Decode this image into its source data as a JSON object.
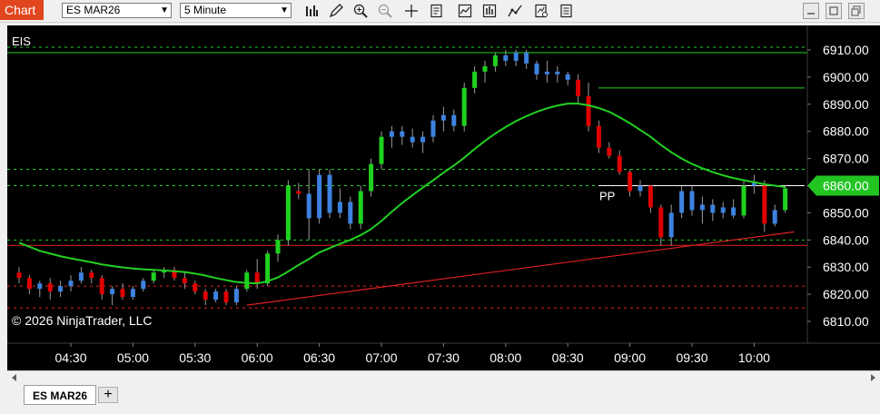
{
  "toolbar": {
    "chart_tab": "Chart",
    "instrument": "ES MAR26",
    "interval": "5 Minute",
    "tools": [
      "bars-icon",
      "pencil-icon",
      "zoom-in-icon",
      "zoom-out-icon",
      "crosshair-icon",
      "data-box-icon",
      "indicators-icon",
      "strategies-icon",
      "drawing-tools-icon",
      "properties-icon",
      "templates-icon"
    ]
  },
  "chart": {
    "instrument_label": "EIS",
    "copyright": "© 2026 NinjaTrader, LLC",
    "pp_label": "PP",
    "price_label": "6860.00",
    "colors": {
      "up": "#1ed21e",
      "down": "#e00000",
      "neutral": "#3d82e0",
      "wick": "#9a9a9a",
      "ma": "#22d022",
      "trend": "#e02020"
    },
    "price_axis": [
      "6910.00",
      "6900.00",
      "6890.00",
      "6880.00",
      "6870.00",
      "6860.00",
      "6850.00",
      "6840.00",
      "6830.00",
      "6820.00",
      "6810.00"
    ],
    "time_axis": [
      "04:30",
      "05:00",
      "05:30",
      "06:00",
      "06:30",
      "07:00",
      "07:30",
      "08:00",
      "08:30",
      "09:00",
      "09:30",
      "10:00"
    ]
  },
  "chart_data": {
    "type": "candlestick",
    "instrument": "ES MAR26",
    "interval": "5 Minute",
    "ylim": [
      6806,
      6913
    ],
    "x": [
      "04:05",
      "04:10",
      "04:15",
      "04:20",
      "04:25",
      "04:30",
      "04:35",
      "04:40",
      "04:45",
      "04:50",
      "04:55",
      "05:00",
      "05:05",
      "05:10",
      "05:15",
      "05:20",
      "05:25",
      "05:30",
      "05:35",
      "05:40",
      "05:45",
      "05:50",
      "05:55",
      "06:00",
      "06:05",
      "06:10",
      "06:15",
      "06:20",
      "06:25",
      "06:30",
      "06:35",
      "06:40",
      "06:45",
      "06:50",
      "06:55",
      "07:00",
      "07:05",
      "07:10",
      "07:15",
      "07:20",
      "07:25",
      "07:30",
      "07:35",
      "07:40",
      "07:45",
      "07:50",
      "07:55",
      "08:00",
      "08:05",
      "08:10",
      "08:15",
      "08:20",
      "08:25",
      "08:30",
      "08:35",
      "08:40",
      "08:45",
      "08:50",
      "08:55",
      "09:00",
      "09:05",
      "09:10",
      "09:15",
      "09:20",
      "09:25",
      "09:30",
      "09:35",
      "09:40",
      "09:45",
      "09:50",
      "09:55",
      "10:00",
      "10:05",
      "10:10",
      "10:15"
    ],
    "candles": [
      {
        "o": 6828,
        "h": 6830,
        "l": 6824,
        "c": 6826,
        "d": "down"
      },
      {
        "o": 6826,
        "h": 6827,
        "l": 6820,
        "c": 6822,
        "d": "down"
      },
      {
        "o": 6822,
        "h": 6825,
        "l": 6819,
        "c": 6824,
        "d": "neutral"
      },
      {
        "o": 6824,
        "h": 6826,
        "l": 6818,
        "c": 6821,
        "d": "down"
      },
      {
        "o": 6821,
        "h": 6825,
        "l": 6819,
        "c": 6823,
        "d": "neutral"
      },
      {
        "o": 6823,
        "h": 6827,
        "l": 6821,
        "c": 6825,
        "d": "neutral"
      },
      {
        "o": 6825,
        "h": 6830,
        "l": 6824,
        "c": 6828,
        "d": "neutral"
      },
      {
        "o": 6828,
        "h": 6829,
        "l": 6824,
        "c": 6826,
        "d": "down"
      },
      {
        "o": 6826,
        "h": 6827,
        "l": 6818,
        "c": 6820,
        "d": "down"
      },
      {
        "o": 6820,
        "h": 6823,
        "l": 6816,
        "c": 6822,
        "d": "neutral"
      },
      {
        "o": 6822,
        "h": 6824,
        "l": 6818,
        "c": 6819,
        "d": "down"
      },
      {
        "o": 6819,
        "h": 6823,
        "l": 6818,
        "c": 6822,
        "d": "neutral"
      },
      {
        "o": 6822,
        "h": 6826,
        "l": 6821,
        "c": 6825,
        "d": "neutral"
      },
      {
        "o": 6825,
        "h": 6829,
        "l": 6824,
        "c": 6828,
        "d": "up"
      },
      {
        "o": 6828,
        "h": 6830,
        "l": 6826,
        "c": 6829,
        "d": "up"
      },
      {
        "o": 6829,
        "h": 6830,
        "l": 6825,
        "c": 6826,
        "d": "down"
      },
      {
        "o": 6826,
        "h": 6828,
        "l": 6822,
        "c": 6824,
        "d": "down"
      },
      {
        "o": 6824,
        "h": 6825,
        "l": 6820,
        "c": 6821,
        "d": "down"
      },
      {
        "o": 6821,
        "h": 6822,
        "l": 6816,
        "c": 6818,
        "d": "down"
      },
      {
        "o": 6818,
        "h": 6822,
        "l": 6817,
        "c": 6821,
        "d": "neutral"
      },
      {
        "o": 6821,
        "h": 6822,
        "l": 6816,
        "c": 6817,
        "d": "down"
      },
      {
        "o": 6817,
        "h": 6823,
        "l": 6816,
        "c": 6822,
        "d": "neutral"
      },
      {
        "o": 6822,
        "h": 6829,
        "l": 6821,
        "c": 6828,
        "d": "up"
      },
      {
        "o": 6828,
        "h": 6833,
        "l": 6822,
        "c": 6824,
        "d": "down"
      },
      {
        "o": 6824,
        "h": 6836,
        "l": 6823,
        "c": 6835,
        "d": "up"
      },
      {
        "o": 6835,
        "h": 6842,
        "l": 6832,
        "c": 6840,
        "d": "up"
      },
      {
        "o": 6840,
        "h": 6862,
        "l": 6838,
        "c": 6860,
        "d": "up"
      },
      {
        "o": 6858,
        "h": 6861,
        "l": 6855,
        "c": 6857,
        "d": "down"
      },
      {
        "o": 6857,
        "h": 6866,
        "l": 6840,
        "c": 6848,
        "d": "neutral"
      },
      {
        "o": 6848,
        "h": 6866,
        "l": 6846,
        "c": 6864,
        "d": "neutral"
      },
      {
        "o": 6864,
        "h": 6866,
        "l": 6848,
        "c": 6850,
        "d": "neutral"
      },
      {
        "o": 6850,
        "h": 6859,
        "l": 6848,
        "c": 6854,
        "d": "neutral"
      },
      {
        "o": 6854,
        "h": 6856,
        "l": 6844,
        "c": 6846,
        "d": "neutral"
      },
      {
        "o": 6846,
        "h": 6860,
        "l": 6844,
        "c": 6858,
        "d": "up"
      },
      {
        "o": 6858,
        "h": 6870,
        "l": 6856,
        "c": 6868,
        "d": "up"
      },
      {
        "o": 6868,
        "h": 6880,
        "l": 6866,
        "c": 6878,
        "d": "up"
      },
      {
        "o": 6878,
        "h": 6882,
        "l": 6874,
        "c": 6880,
        "d": "neutral"
      },
      {
        "o": 6880,
        "h": 6882,
        "l": 6875,
        "c": 6878,
        "d": "neutral"
      },
      {
        "o": 6878,
        "h": 6881,
        "l": 6874,
        "c": 6876,
        "d": "neutral"
      },
      {
        "o": 6876,
        "h": 6880,
        "l": 6872,
        "c": 6878,
        "d": "neutral"
      },
      {
        "o": 6878,
        "h": 6886,
        "l": 6876,
        "c": 6884,
        "d": "neutral"
      },
      {
        "o": 6884,
        "h": 6889,
        "l": 6880,
        "c": 6886,
        "d": "neutral"
      },
      {
        "o": 6886,
        "h": 6888,
        "l": 6880,
        "c": 6882,
        "d": "neutral"
      },
      {
        "o": 6882,
        "h": 6898,
        "l": 6880,
        "c": 6896,
        "d": "up"
      },
      {
        "o": 6896,
        "h": 6904,
        "l": 6894,
        "c": 6902,
        "d": "up"
      },
      {
        "o": 6902,
        "h": 6906,
        "l": 6898,
        "c": 6904,
        "d": "up"
      },
      {
        "o": 6904,
        "h": 6909,
        "l": 6902,
        "c": 6908,
        "d": "up"
      },
      {
        "o": 6908,
        "h": 6910,
        "l": 6904,
        "c": 6906,
        "d": "neutral"
      },
      {
        "o": 6906,
        "h": 6910,
        "l": 6904,
        "c": 6909,
        "d": "neutral"
      },
      {
        "o": 6909,
        "h": 6910,
        "l": 6903,
        "c": 6905,
        "d": "neutral"
      },
      {
        "o": 6905,
        "h": 6906,
        "l": 6899,
        "c": 6901,
        "d": "neutral"
      },
      {
        "o": 6901,
        "h": 6906,
        "l": 6898,
        "c": 6902,
        "d": "neutral"
      },
      {
        "o": 6902,
        "h": 6904,
        "l": 6898,
        "c": 6901,
        "d": "neutral"
      },
      {
        "o": 6901,
        "h": 6902,
        "l": 6897,
        "c": 6899,
        "d": "neutral"
      },
      {
        "o": 6899,
        "h": 6901,
        "l": 6890,
        "c": 6893,
        "d": "down"
      },
      {
        "o": 6893,
        "h": 6898,
        "l": 6880,
        "c": 6882,
        "d": "down"
      },
      {
        "o": 6882,
        "h": 6884,
        "l": 6872,
        "c": 6874,
        "d": "down"
      },
      {
        "o": 6874,
        "h": 6876,
        "l": 6870,
        "c": 6871,
        "d": "down"
      },
      {
        "o": 6871,
        "h": 6873,
        "l": 6864,
        "c": 6865,
        "d": "down"
      },
      {
        "o": 6865,
        "h": 6866,
        "l": 6856,
        "c": 6858,
        "d": "down"
      },
      {
        "o": 6858,
        "h": 6862,
        "l": 6856,
        "c": 6860,
        "d": "neutral"
      },
      {
        "o": 6860,
        "h": 6860,
        "l": 6850,
        "c": 6852,
        "d": "down"
      },
      {
        "o": 6852,
        "h": 6853,
        "l": 6838,
        "c": 6841,
        "d": "down"
      },
      {
        "o": 6841,
        "h": 6853,
        "l": 6838,
        "c": 6850,
        "d": "neutral"
      },
      {
        "o": 6850,
        "h": 6860,
        "l": 6848,
        "c": 6858,
        "d": "neutral"
      },
      {
        "o": 6858,
        "h": 6860,
        "l": 6849,
        "c": 6851,
        "d": "neutral"
      },
      {
        "o": 6851,
        "h": 6856,
        "l": 6846,
        "c": 6853,
        "d": "neutral"
      },
      {
        "o": 6853,
        "h": 6855,
        "l": 6847,
        "c": 6850,
        "d": "neutral"
      },
      {
        "o": 6850,
        "h": 6854,
        "l": 6848,
        "c": 6852,
        "d": "neutral"
      },
      {
        "o": 6852,
        "h": 6855,
        "l": 6848,
        "c": 6849,
        "d": "neutral"
      },
      {
        "o": 6849,
        "h": 6862,
        "l": 6848,
        "c": 6860,
        "d": "up"
      },
      {
        "o": 6860,
        "h": 6864,
        "l": 6857,
        "c": 6861,
        "d": "neutral"
      },
      {
        "o": 6860,
        "h": 6862,
        "l": 6843,
        "c": 6846,
        "d": "down"
      },
      {
        "o": 6846,
        "h": 6853,
        "l": 6845,
        "c": 6851,
        "d": "neutral"
      },
      {
        "o": 6851,
        "h": 6860,
        "l": 6850,
        "c": 6859,
        "d": "up"
      }
    ],
    "moving_average": [
      6839,
      6837.5,
      6836,
      6835,
      6834,
      6833.2,
      6832.5,
      6831.8,
      6831,
      6830.4,
      6829.9,
      6829.5,
      6829.2,
      6829,
      6828.8,
      6828.5,
      6828.2,
      6827.6,
      6826.9,
      6826,
      6825.2,
      6824.5,
      6824.2,
      6824,
      6824.8,
      6826.2,
      6828.4,
      6830.8,
      6833,
      6835.4,
      6837,
      6838.6,
      6840,
      6841.8,
      6844,
      6847,
      6850.4,
      6853.6,
      6856.5,
      6859.3,
      6862,
      6864.8,
      6867.4,
      6870.3,
      6873.5,
      6876.5,
      6879.2,
      6881.6,
      6883.8,
      6885.6,
      6887.2,
      6888.5,
      6889.5,
      6890.2,
      6890.2,
      6889.6,
      6888.6,
      6887.2,
      6885.2,
      6883,
      6880.5,
      6878,
      6875,
      6872.3,
      6870,
      6868,
      6866.4,
      6865,
      6863.8,
      6862.8,
      6862,
      6861.3,
      6860.5,
      6860,
      6859.5
    ],
    "horizontal_levels": [
      {
        "label": "",
        "price": 6909,
        "style": "solid",
        "color": "#1ed21e"
      },
      {
        "label": "",
        "price": 6911,
        "style": "dotted",
        "color": "#1ed21e"
      },
      {
        "label": "",
        "price": 6866,
        "style": "dotted",
        "color": "#1ed21e"
      },
      {
        "label": "",
        "price": 6860,
        "style": "dotted",
        "color": "#1ed21e"
      },
      {
        "label": "",
        "price": 6840,
        "style": "dotted",
        "color": "#1ed21e"
      },
      {
        "label": "",
        "price": 6838,
        "style": "solid",
        "color": "#e02020"
      },
      {
        "label": "",
        "price": 6823,
        "style": "dotted",
        "color": "#e02020"
      },
      {
        "label": "",
        "price": 6815,
        "style": "dotted",
        "color": "#e02020"
      },
      {
        "label": "",
        "price": 6896,
        "style": "solid",
        "color": "#1ed21e"
      },
      {
        "label": "PP",
        "price": 6860,
        "style": "solid",
        "color": "#ffffff"
      }
    ],
    "trend_line": {
      "from": {
        "x": "05:55",
        "price": 6816
      },
      "to": {
        "x": "10:15",
        "price": 6843
      }
    },
    "last_price": 6860.0
  }
}
